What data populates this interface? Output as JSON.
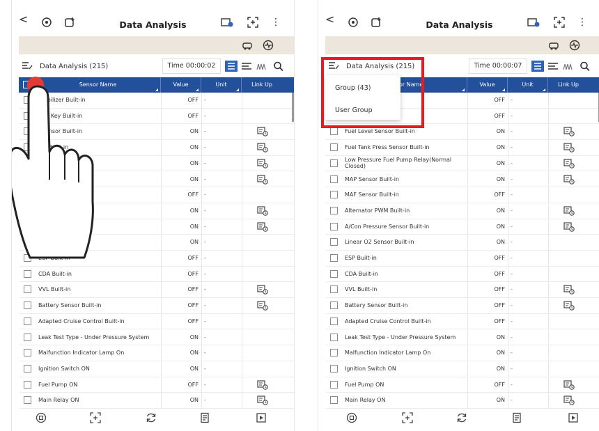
{
  "app": {
    "title": "Data Analysis",
    "back_label": "<",
    "menu_label": "⋮",
    "icons": [
      "back-arrow-icon",
      "engine-icon",
      "gauge-plus-icon",
      "battery-mail-icon",
      "expand-icon",
      "kebab-icon"
    ]
  },
  "toolstrip": {
    "icons": [
      "car-tool-icon",
      "sensor-wave-icon"
    ]
  },
  "databar": {
    "left": {
      "title": "Data Analysis (215)",
      "time": "Time 00:00:02"
    },
    "right": {
      "title": "Data Analysis (215)",
      "time": "Time 00:00:07"
    }
  },
  "columns": {
    "name": "Sensor Name",
    "value": "Value",
    "unit": "Unit",
    "link": "Link Up"
  },
  "left_rows": [
    {
      "name": "mobilizer Built-in",
      "value": "OFF",
      "unit": "-",
      "link": false
    },
    {
      "name": "ART Key Built-in",
      "value": "OFF",
      "unit": "-",
      "link": false
    },
    {
      "name": "l Sensor Built-in",
      "value": "ON",
      "unit": "-",
      "link": true
    },
    {
      "name": "sor Built-in",
      "value": "ON",
      "unit": "-",
      "link": true
    },
    {
      "name": "mp Relay(Normal",
      "value": "ON",
      "unit": "-",
      "link": true
    },
    {
      "name": "",
      "value": "ON",
      "unit": "-",
      "link": true
    },
    {
      "name": "",
      "value": "OFF",
      "unit": "-",
      "link": false
    },
    {
      "name": "ilt-in",
      "value": "ON",
      "unit": "-",
      "link": true
    },
    {
      "name": "ensor Built-in",
      "value": "ON",
      "unit": "-",
      "link": true
    },
    {
      "name": "Built-in",
      "value": "ON",
      "unit": "-",
      "link": false
    },
    {
      "name": "ESP Built-in",
      "value": "OFF",
      "unit": "-",
      "link": false
    },
    {
      "name": "CDA Built-in",
      "value": "OFF",
      "unit": "-",
      "link": false
    },
    {
      "name": "VVL Built-in",
      "value": "OFF",
      "unit": "-",
      "link": true
    },
    {
      "name": "Battery Sensor Built-in",
      "value": "OFF",
      "unit": "-",
      "link": true
    },
    {
      "name": "Adapted Cruise Control Built-in",
      "value": "OFF",
      "unit": "-",
      "link": false
    },
    {
      "name": "Leak Test Type - Under Pressure System",
      "value": "ON",
      "unit": "-",
      "link": false
    },
    {
      "name": "Malfunction Indicator Lamp On",
      "value": "ON",
      "unit": "-",
      "link": false
    },
    {
      "name": "Ignition Switch ON",
      "value": "ON",
      "unit": "-",
      "link": false
    },
    {
      "name": "Fuel Pump ON",
      "value": "OFF",
      "unit": "-",
      "link": true
    },
    {
      "name": "Main Relay ON",
      "value": "ON",
      "unit": "-",
      "link": true
    }
  ],
  "right_rows": [
    {
      "name": "",
      "value": "OFF",
      "unit": "-",
      "link": false
    },
    {
      "name": "",
      "value": "OFF",
      "unit": "-",
      "link": false
    },
    {
      "name": "Fuel Level Sensor Built-in",
      "value": "ON",
      "unit": "-",
      "link": true
    },
    {
      "name": "Fuel Tank Press Sensor Built-in",
      "value": "ON",
      "unit": "-",
      "link": true
    },
    {
      "name": "Low Pressure Fuel Pump Relay(Normal Closed)",
      "value": "ON",
      "unit": "-",
      "link": true
    },
    {
      "name": "MAP Sensor Built-in",
      "value": "ON",
      "unit": "-",
      "link": true
    },
    {
      "name": "MAF Sensor Built-in",
      "value": "OFF",
      "unit": "-",
      "link": false
    },
    {
      "name": "Alternator PWM Built-in",
      "value": "ON",
      "unit": "-",
      "link": true
    },
    {
      "name": "A/Con Pressure Sensor Built-in",
      "value": "ON",
      "unit": "-",
      "link": true
    },
    {
      "name": "Linear O2 Sensor Built-in",
      "value": "ON",
      "unit": "-",
      "link": false
    },
    {
      "name": "ESP Built-in",
      "value": "OFF",
      "unit": "-",
      "link": false
    },
    {
      "name": "CDA Built-in",
      "value": "OFF",
      "unit": "-",
      "link": false
    },
    {
      "name": "VVL Built-in",
      "value": "OFF",
      "unit": "-",
      "link": true
    },
    {
      "name": "Battery Sensor Built-in",
      "value": "OFF",
      "unit": "-",
      "link": true
    },
    {
      "name": "Adapted Cruise Control Built-in",
      "value": "OFF",
      "unit": "-",
      "link": false
    },
    {
      "name": "Leak Test Type - Under Pressure System",
      "value": "ON",
      "unit": "-",
      "link": false
    },
    {
      "name": "Malfunction Indicator Lamp On",
      "value": "ON",
      "unit": "-",
      "link": false
    },
    {
      "name": "Ignition Switch ON",
      "value": "ON",
      "unit": "-",
      "link": false
    },
    {
      "name": "Fuel Pump ON",
      "value": "OFF",
      "unit": "-",
      "link": true
    },
    {
      "name": "Main Relay ON",
      "value": "ON",
      "unit": "-",
      "link": true
    }
  ],
  "popup": {
    "items": [
      "Group (43)",
      "User Group"
    ]
  },
  "bottom_nav_icons": [
    "stop-icon",
    "expand-icon",
    "refresh-icon",
    "report-icon",
    "record-icon"
  ],
  "colors": {
    "header_blue": "#23509b",
    "highlight_red": "#e61b23",
    "toolstrip_beige": "#ece6dc"
  }
}
